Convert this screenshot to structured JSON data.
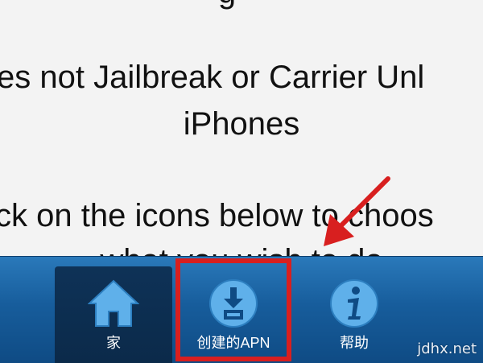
{
  "content": {
    "lines": [
      "es not Jailbreak or Carrier Unl",
      "iPhones",
      "ck on the icons below to choos",
      "what you wish to do"
    ]
  },
  "tabbar": {
    "tabs": [
      {
        "label": "家",
        "icon": "home-icon",
        "selected": true
      },
      {
        "label": "创建的APN",
        "icon": "download-apn-icon",
        "selected": false
      },
      {
        "label": "帮助",
        "icon": "info-icon",
        "selected": false
      }
    ]
  },
  "annotation": {
    "color": "#d81f1f"
  },
  "watermark": {
    "text": "jdhx.net"
  },
  "colors": {
    "tabbar_blue": "#175d9c",
    "tab_selected": "#0e3257",
    "icon_blue": "#5fb0ea",
    "annotation_red": "#d81f1f"
  }
}
